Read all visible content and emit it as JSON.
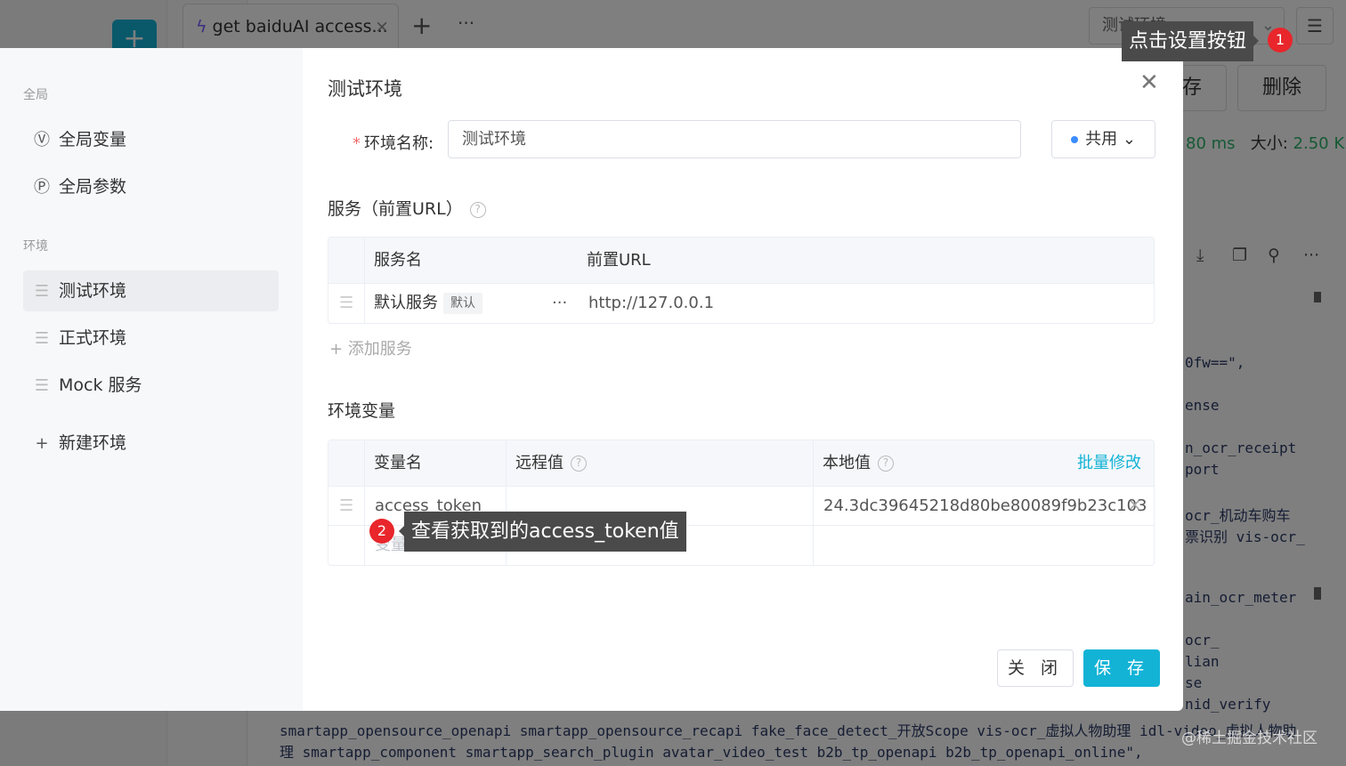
{
  "background": {
    "tab_title": "get baiduAI access...",
    "tab_close": "×",
    "tab_add": "+",
    "tab_more": "···",
    "env_select": "测试环境",
    "save_partial": "存",
    "delete": "删除",
    "timing": "80 ms",
    "size_label": "大小: ",
    "size_value": "2.50 K",
    "code_lines": [
      "0fw==\",",
      "ense",
      "n_ocr_receipt",
      "port",
      "ocr_机动车购车",
      "票识别 vis-ocr_",
      "ain_ocr_meter",
      "ocr_",
      "lian",
      "se",
      "nid_verify"
    ],
    "code_bottom_1": "smartapp_opensource_openapi smartapp_opensource_recapi fake_face_detect_开放Scope vis-ocr_虚拟人物助理 idl-video_虚拟人物助",
    "code_bottom_2": "理 smartapp_component smartapp_search_plugin avatar_video_test b2b_tp_openapi b2b_tp_openapi_online\",",
    "watermark": "@稀土掘金技术社区"
  },
  "sidebar": {
    "group_global": "全局",
    "global_items": [
      {
        "label": "全局变量",
        "icon": "Ⓥ"
      },
      {
        "label": "全局参数",
        "icon": "Ⓟ"
      }
    ],
    "group_env": "环境",
    "env_items": [
      {
        "label": "测试环境"
      },
      {
        "label": "正式环境"
      },
      {
        "label": "Mock 服务"
      }
    ],
    "new_env": "新建环境"
  },
  "dialog": {
    "title": "测试环境",
    "env_name_label": "环境名称:",
    "env_name_value": "测试环境",
    "share_label": "共用",
    "services_title": "服务（前置URL）",
    "services_headers": [
      "服务名",
      "前置URL"
    ],
    "services_rows": [
      {
        "name": "默认服务",
        "tag": "默认",
        "more": "···",
        "url": "http://127.0.0.1"
      }
    ],
    "add_service": "添加服务",
    "vars_title": "环境变量",
    "vars_headers": {
      "name": "变量名",
      "remote": "远程值",
      "local": "本地值",
      "batch": "批量修改"
    },
    "vars_rows": [
      {
        "name": "access_token",
        "remote": "",
        "local": "24.3dc39645218d80be80089f9b23c103"
      }
    ],
    "vars_new_placeholder": "变量名",
    "close_button": "关 闭",
    "save_button": "保 存"
  },
  "tooltips": {
    "tip1": "点击设置按钮",
    "badge1": "1",
    "tip2": "查看获取到的access_token值",
    "badge2": "2"
  }
}
